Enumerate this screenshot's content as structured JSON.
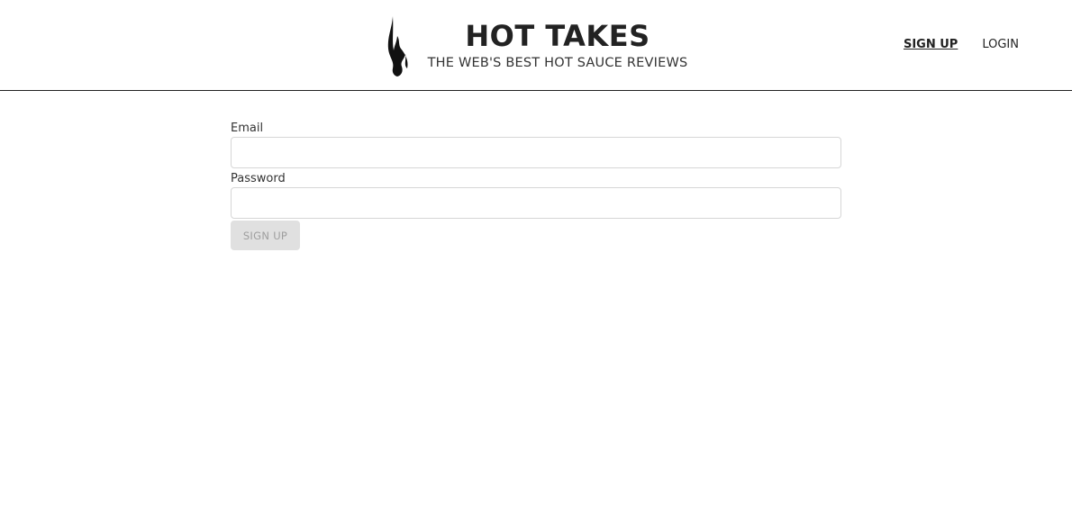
{
  "header": {
    "title": "HOT TAKES",
    "subtitle": "THE WEB'S BEST HOT SAUCE REVIEWS",
    "logo_icon": "flame-icon"
  },
  "nav": {
    "items": [
      {
        "label": "SIGN UP",
        "active": true
      },
      {
        "label": "LOGIN",
        "active": false
      }
    ]
  },
  "form": {
    "email_label": "Email",
    "email_value": "",
    "password_label": "Password",
    "password_value": "",
    "submit_label": "SIGN UP",
    "submit_disabled": true
  },
  "colors": {
    "text": "#222222",
    "divider": "#222222",
    "button_disabled_bg": "#e0e0e0",
    "button_disabled_text": "#9e9e9e"
  }
}
